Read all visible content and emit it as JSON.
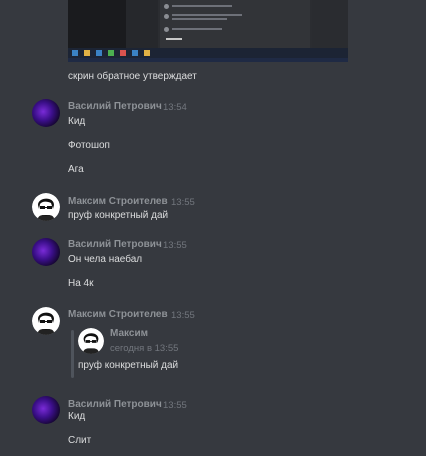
{
  "messages": {
    "top_caption": "скрин обратное утверждает",
    "m1": {
      "author": "Василий Петрович",
      "time": "13:54",
      "lines": [
        "Кид",
        "Фотошоп",
        "Ага"
      ]
    },
    "m2": {
      "author": "Максим Строителев",
      "time": "13:55",
      "lines": [
        "пруф конкретный дай"
      ]
    },
    "m3": {
      "author": "Василий Петрович",
      "time": "13:55",
      "lines": [
        "Он чела наебал",
        "На 4к"
      ]
    },
    "m4": {
      "author": "Максим Строителев",
      "time": "13:55",
      "quote": {
        "author": "Максим",
        "time": "сегодня в 13:55",
        "text": "пруф конкретный дай"
      }
    },
    "m5": {
      "author": "Василий Петрович",
      "time": "13:55",
      "lines": [
        "Кид",
        "Слит"
      ]
    }
  },
  "colors": {
    "background": "#36393f",
    "text": "#dcddde",
    "muted": "#8e9297",
    "timestamp": "#72767d"
  }
}
